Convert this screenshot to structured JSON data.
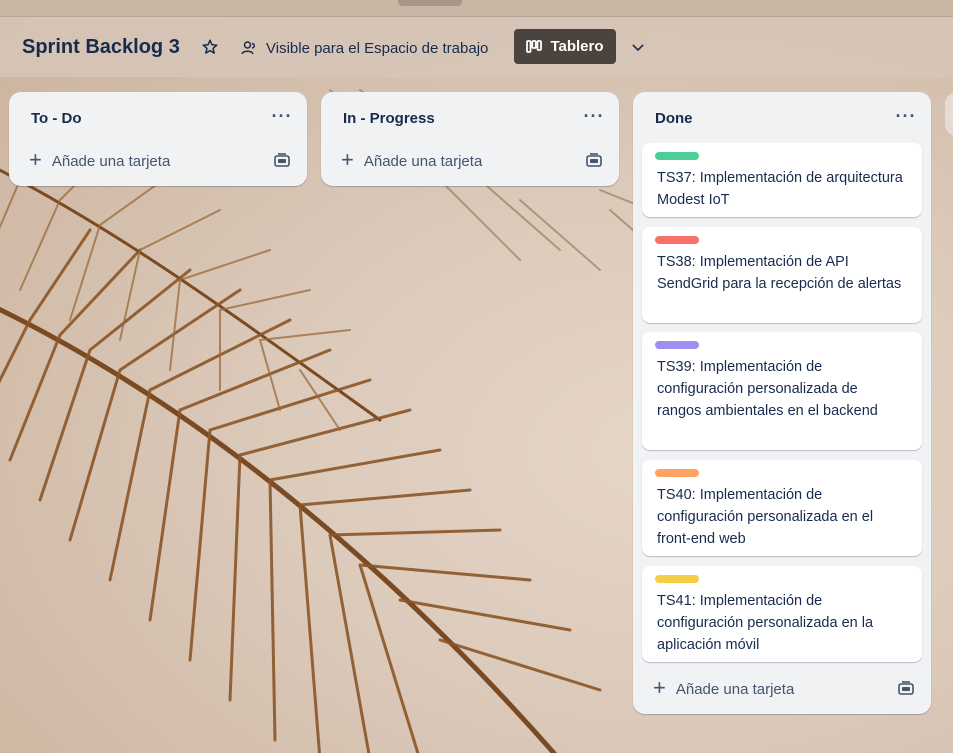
{
  "board": {
    "title": "Sprint Backlog 3",
    "visibility_label": "Visible para el Espacio de trabajo",
    "view_label": "Tablero",
    "icons": {
      "star": "star-icon",
      "visibility": "people-icon",
      "view": "board-icon",
      "chevron": "chevron-down-icon"
    }
  },
  "lists": [
    {
      "title": "To - Do",
      "menu_label": "···",
      "add_card_label": "Añade una tarjeta",
      "cards": []
    },
    {
      "title": "In - Progress",
      "menu_label": "···",
      "add_card_label": "Añade una tarjeta",
      "cards": []
    },
    {
      "title": "Done",
      "menu_label": "···",
      "add_card_label": "Añade una tarjeta",
      "cards": [
        {
          "label_color": "#4bce97",
          "text": "TS37: Implementación de arquitectura Modest IoT"
        },
        {
          "label_color": "#f87168",
          "text": "TS38: Implementación de API SendGrid para la recepción de alertas"
        },
        {
          "label_color": "#9f8fef",
          "text": "TS39: Implementación de configuración personalizada de rangos ambientales en el backend"
        },
        {
          "label_color": "#fea362",
          "text": "TS40: Implementación de configuración personalizada en el front-end web"
        },
        {
          "label_color": "#f5cd47",
          "text": "TS41: Implementación de configuración personalizada en la aplicación móvil"
        }
      ]
    }
  ]
}
